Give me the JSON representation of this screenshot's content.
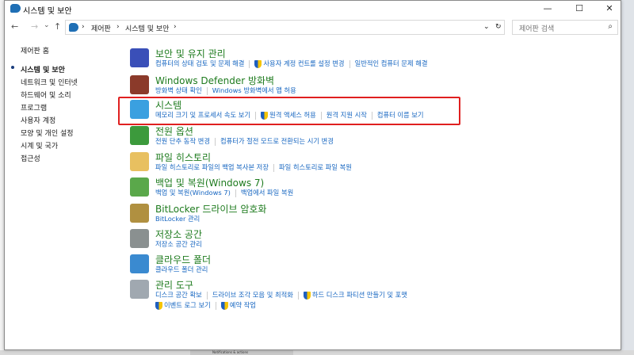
{
  "window": {
    "title": "시스템 및 보안",
    "controls": {
      "minimize": "—",
      "maximize": "☐",
      "close": "✕"
    }
  },
  "address": {
    "crumbs": [
      "제어판",
      "시스템 및 보안"
    ],
    "search_placeholder": "제어판 검색"
  },
  "nav": {
    "back": "←",
    "forward": "→",
    "recent": "⌄",
    "up": "↑",
    "dropdown": "⌄",
    "refresh": "↻",
    "search_icon": "⌕",
    "chevron": "›"
  },
  "sidebar": {
    "items": [
      {
        "label": "제어판 홈"
      },
      {
        "label": "시스템 및 보안"
      },
      {
        "label": "네트워크 및 인터넷"
      },
      {
        "label": "하드웨어 및 소리"
      },
      {
        "label": "프로그램"
      },
      {
        "label": "사용자 계정"
      },
      {
        "label": "모양 및 개인 설정"
      },
      {
        "label": "시계 및 국가"
      },
      {
        "label": "접근성"
      }
    ]
  },
  "categories": [
    {
      "title": "보안 및 유지 관리",
      "icon": "flag-icon",
      "color": "#3a4fb8",
      "links": [
        {
          "text": "컴퓨터의 상태 검토 및 문제 해결"
        },
        {
          "text": "사용자 계정 컨트롤 설정 변경",
          "shield": true
        },
        {
          "text": "일반적인 컴퓨터 문제 해결"
        }
      ]
    },
    {
      "title": "Windows Defender 방화벽",
      "icon": "firewall-icon",
      "color": "#8b3a2a",
      "links": [
        {
          "text": "방화벽 상태 확인"
        },
        {
          "text": "Windows 방화벽에서 앱 허용"
        }
      ]
    },
    {
      "title": "시스템",
      "icon": "computer-icon",
      "color": "#3aa0e0",
      "links": [
        {
          "text": "메모리 크기 및 프로세서 속도 보기"
        },
        {
          "text": "원격 액세스 허용",
          "shield": true
        },
        {
          "text": "원격 지원 시작"
        },
        {
          "text": "컴퓨터 이름 보기"
        }
      ]
    },
    {
      "title": "전원 옵션",
      "icon": "battery-icon",
      "color": "#3c9a3c",
      "links": [
        {
          "text": "전원 단추 동작 변경"
        },
        {
          "text": "컴퓨터가 절전 모드로 전환되는 시기 변경"
        }
      ]
    },
    {
      "title": "파일 히스토리",
      "icon": "file-history-icon",
      "color": "#e8c060",
      "links": [
        {
          "text": "파일 히스토리로 파일의 백업 복사본 저장"
        },
        {
          "text": "파일 히스토리로 파일 복원"
        }
      ]
    },
    {
      "title": "백업 및 복원(Windows 7)",
      "icon": "backup-icon",
      "color": "#5aa84a",
      "links": [
        {
          "text": "백업 및 복원(Windows 7)"
        },
        {
          "text": "백업에서 파일 복원"
        }
      ]
    },
    {
      "title": "BitLocker 드라이브 암호화",
      "icon": "bitlocker-icon",
      "color": "#b09040",
      "links": [
        {
          "text": "BitLocker 관리"
        }
      ]
    },
    {
      "title": "저장소 공간",
      "icon": "storage-icon",
      "color": "#8a9090",
      "links": [
        {
          "text": "저장소 공간 관리"
        }
      ]
    },
    {
      "title": "클라우드 폴더",
      "icon": "cloud-folder-icon",
      "color": "#3a8ad0",
      "links": [
        {
          "text": "클라우드 폴더 관리"
        }
      ]
    },
    {
      "title": "관리 도구",
      "icon": "admin-tools-icon",
      "color": "#a0a8b0",
      "links": [
        {
          "text": "디스크 공간 확보"
        },
        {
          "text": "드라이브 조각 모음 및 최적화"
        },
        {
          "text": "하드 디스크 파티션 만들기 및 포맷",
          "shield": true
        },
        {
          "text": "이벤트 로그 보기",
          "shield": true,
          "newline": true
        },
        {
          "text": "예약 작업",
          "shield": true
        }
      ]
    }
  ],
  "taskbar": {
    "text": "Notifications & actions"
  }
}
